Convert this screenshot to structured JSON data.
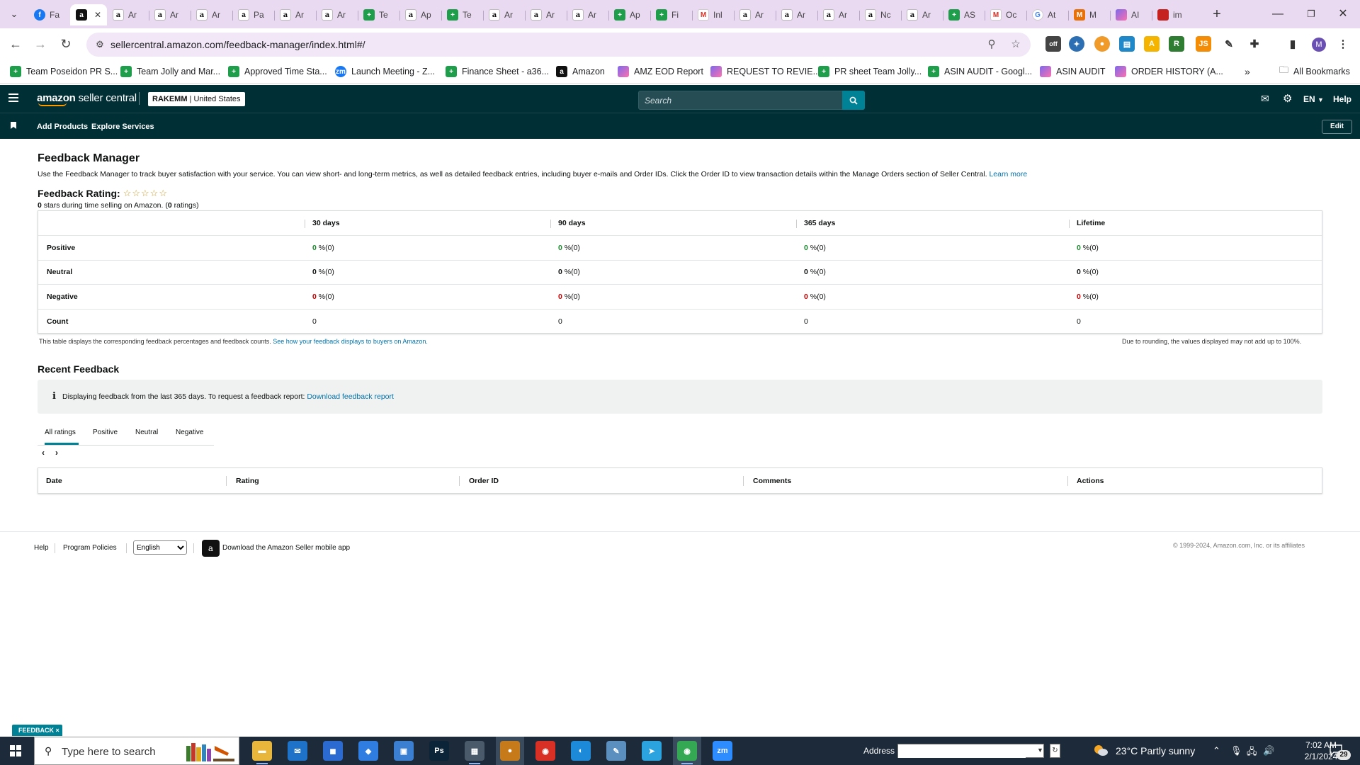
{
  "browser": {
    "tabs": [
      {
        "icon": "facebook-icon",
        "label": "Fa",
        "glyph": "f",
        "cls": "fb"
      },
      {
        "icon": "amazon-icon",
        "label": "",
        "glyph": "a",
        "cls": "active-amz",
        "active": true
      },
      {
        "icon": "amazon-icon",
        "label": "Ar",
        "glyph": "a",
        "cls": "amazon"
      },
      {
        "icon": "amazon-icon",
        "label": "Ar",
        "glyph": "a",
        "cls": "amazon"
      },
      {
        "icon": "amazon-icon",
        "label": "Ar",
        "glyph": "a",
        "cls": "amazon"
      },
      {
        "icon": "amazon-icon",
        "label": "Pa",
        "glyph": "a",
        "cls": "pa"
      },
      {
        "icon": "amazon-icon",
        "label": "Ar",
        "glyph": "a",
        "cls": "amazon"
      },
      {
        "icon": "amazon-icon",
        "label": "Ar",
        "glyph": "a",
        "cls": "amazon"
      },
      {
        "icon": "sheets-icon",
        "label": "Te",
        "glyph": "+",
        "cls": "sheets"
      },
      {
        "icon": "amazon-icon",
        "label": "Ap",
        "glyph": "a",
        "cls": "amazon"
      },
      {
        "icon": "sheets-icon",
        "label": "Te",
        "glyph": "+",
        "cls": "sheets"
      },
      {
        "icon": "amazon-icon",
        "label": "Ar",
        "glyph": "a",
        "cls": "amazon"
      },
      {
        "icon": "amazon-icon",
        "label": "Ar",
        "glyph": "a",
        "cls": "amazon"
      },
      {
        "icon": "amazon-icon",
        "label": "Ar",
        "glyph": "a",
        "cls": "amazon"
      },
      {
        "icon": "sheets-icon",
        "label": "Ap",
        "glyph": "+",
        "cls": "sheets"
      },
      {
        "icon": "sheets-icon",
        "label": "Fi",
        "glyph": "+",
        "cls": "sheets"
      },
      {
        "icon": "gmail-icon",
        "label": "Inl",
        "glyph": "M",
        "cls": "gmail"
      },
      {
        "icon": "amazon-icon",
        "label": "Ar",
        "glyph": "a",
        "cls": "amazon"
      },
      {
        "icon": "amazon-icon",
        "label": "Ar",
        "glyph": "a",
        "cls": "amazon"
      },
      {
        "icon": "amazon-icon",
        "label": "Ar",
        "glyph": "a",
        "cls": "amazon"
      },
      {
        "icon": "amazon-icon",
        "label": "Nc",
        "glyph": "a",
        "cls": "amazon"
      },
      {
        "icon": "amazon-icon",
        "label": "Ar",
        "glyph": "a",
        "cls": "amazon"
      },
      {
        "icon": "sheets-icon",
        "label": "AS",
        "glyph": "+",
        "cls": "sheets"
      },
      {
        "icon": "gmail-icon",
        "label": "Oc",
        "glyph": "M",
        "cls": "gmail"
      },
      {
        "icon": "google-icon",
        "label": "At",
        "glyph": "G",
        "cls": "google"
      },
      {
        "icon": "app-icon",
        "label": "M",
        "glyph": "M",
        "cls": "mix"
      },
      {
        "icon": "clickup-icon",
        "label": "AI",
        "glyph": "",
        "cls": "clickup"
      },
      {
        "icon": "app-icon",
        "label": "im",
        "glyph": "",
        "cls": "red"
      }
    ],
    "url": "sellercentral.amazon.com/feedback-manager/index.html#/",
    "bookmarks": [
      {
        "label": "Team Poseidon PR S...",
        "icon": "sheets-icon",
        "glyph": "+",
        "cls": "sheets"
      },
      {
        "label": "Team Jolly and Mar...",
        "icon": "sheets-icon",
        "glyph": "+",
        "cls": "sheets"
      },
      {
        "label": "Approved Time Sta...",
        "icon": "sheets-icon",
        "glyph": "+",
        "cls": "sheets"
      },
      {
        "label": "Launch Meeting - Z...",
        "icon": "zoom-icon",
        "glyph": "zm",
        "cls": "fb"
      },
      {
        "label": "Finance Sheet - a36...",
        "icon": "sheets-icon",
        "glyph": "+",
        "cls": "sheets"
      },
      {
        "label": "Amazon",
        "icon": "amazon-icon",
        "glyph": "a",
        "cls": "active-amz"
      },
      {
        "label": "AMZ EOD Report",
        "icon": "clickup-icon",
        "glyph": "",
        "cls": "clickup"
      },
      {
        "label": "REQUEST TO REVIE...",
        "icon": "clickup-icon",
        "glyph": "",
        "cls": "clickup"
      },
      {
        "label": "PR sheet Team Jolly...",
        "icon": "sheets-icon",
        "glyph": "+",
        "cls": "sheets"
      },
      {
        "label": "ASIN AUDIT - Googl...",
        "icon": "sheets-icon",
        "glyph": "+",
        "cls": "sheets"
      },
      {
        "label": "ASIN AUDIT",
        "icon": "clickup-icon",
        "glyph": "",
        "cls": "clickup"
      },
      {
        "label": "ORDER HISTORY (A...",
        "icon": "clickup-icon",
        "glyph": "",
        "cls": "clickup"
      }
    ],
    "all_bookmarks": "All Bookmarks",
    "profile_initial": "M"
  },
  "header": {
    "logo_bold": "amazon",
    "logo_light": " seller central",
    "store_name": "RAKEMM",
    "store_market": "United States",
    "search_placeholder": "Search",
    "lang": "EN",
    "help": "Help"
  },
  "subnav": {
    "links": [
      "Add Products",
      "Explore Services"
    ],
    "edit": "Edit"
  },
  "main": {
    "title": "Feedback Manager",
    "intro": "Use the Feedback Manager to track buyer satisfaction with your service. You can view short- and long-term metrics, as well as detailed feedback entries, including buyer e-mails and Order IDs. Click the Order ID to view transaction details within the Manage Orders section of Seller Central.",
    "learn_more": "Learn more",
    "rating_label": "Feedback Rating:",
    "stars": "☆☆☆☆☆",
    "rating_sub_a": "0",
    "rating_sub_b": " stars during time selling on Amazon. (",
    "rating_sub_c": "0",
    "rating_sub_d": " ratings)",
    "columns": [
      "30 days",
      "90 days",
      "365 days",
      "Lifetime"
    ],
    "rows": [
      {
        "label": "Positive",
        "cls": "pos",
        "cells": [
          {
            "num": "0",
            "rest": " %(0)"
          },
          {
            "num": "0",
            "rest": " %(0)"
          },
          {
            "num": "0",
            "rest": " %(0)"
          },
          {
            "num": "0",
            "rest": " %(0)"
          }
        ]
      },
      {
        "label": "Neutral",
        "cls": "neu",
        "cells": [
          {
            "num": "0",
            "rest": " %(0)"
          },
          {
            "num": "0",
            "rest": " %(0)"
          },
          {
            "num": "0",
            "rest": " %(0)"
          },
          {
            "num": "0",
            "rest": " %(0)"
          }
        ]
      },
      {
        "label": "Negative",
        "cls": "neg",
        "cells": [
          {
            "num": "0",
            "rest": " %(0)"
          },
          {
            "num": "0",
            "rest": " %(0)"
          },
          {
            "num": "0",
            "rest": " %(0)"
          },
          {
            "num": "0",
            "rest": " %(0)"
          }
        ]
      },
      {
        "label": "Count",
        "cls": "",
        "cells": [
          {
            "num": "",
            "rest": "0"
          },
          {
            "num": "",
            "rest": "0"
          },
          {
            "num": "",
            "rest": "0"
          },
          {
            "num": "",
            "rest": "0"
          }
        ]
      }
    ],
    "table_note": "This table displays the corresponding feedback percentages and feedback counts.",
    "table_note_link": "See how your feedback displays to buyers on Amazon.",
    "rounding_note": "Due to rounding, the values displayed may not add up to 100%.",
    "recent_title": "Recent Feedback",
    "info_text": "Displaying feedback from the last 365 days. To request a feedback report:",
    "info_link": "Download feedback report",
    "rating_tabs": [
      "All ratings",
      "Positive",
      "Neutral",
      "Negative"
    ],
    "feedback_columns": [
      "Date",
      "Rating",
      "Order ID",
      "Comments",
      "Actions"
    ]
  },
  "footer": {
    "help": "Help",
    "policies": "Program Policies",
    "language": "English",
    "app_text": "Download the Amazon Seller mobile app",
    "copyright": "© 1999-2024, Amazon.com, Inc. or its affiliates",
    "feedback_tab": "FEEDBACK ×"
  },
  "taskbar": {
    "search_placeholder": "Type here to search",
    "address_label": "Address",
    "weather": "23°C  Partly sunny",
    "time": "7:02 AM",
    "date": "2/1/2024",
    "notifications": "29",
    "apps": [
      {
        "name": "file-explorer-icon",
        "glyph": "▬",
        "bg": "#e8b63a"
      },
      {
        "name": "mail-icon",
        "glyph": "✉",
        "bg": "#1e73c9"
      },
      {
        "name": "store-icon",
        "glyph": "◼",
        "bg": "#2b6ad1"
      },
      {
        "name": "copilot-icon",
        "glyph": "◆",
        "bg": "#2f7de1"
      },
      {
        "name": "app-icon",
        "glyph": "▣",
        "bg": "#3a7fd1"
      },
      {
        "name": "photoshop-icon",
        "glyph": "Ps",
        "bg": "#0b2437"
      },
      {
        "name": "calculator-icon",
        "glyph": "▦",
        "bg": "#4a5a6a"
      },
      {
        "name": "media-icon",
        "glyph": "●",
        "bg": "#c77a1a"
      },
      {
        "name": "chrome-icon",
        "glyph": "◉",
        "bg": "#d93025"
      },
      {
        "name": "edge-icon",
        "glyph": "◐",
        "bg": "#1c8ad8"
      },
      {
        "name": "notes-icon",
        "glyph": "✎",
        "bg": "#5a8fc0"
      },
      {
        "name": "telegram-icon",
        "glyph": "➤",
        "bg": "#2aa3df"
      },
      {
        "name": "chrome-profile-icon",
        "glyph": "◉",
        "bg": "#34a853"
      },
      {
        "name": "zoom-icon",
        "glyph": "zm",
        "bg": "#2d8cff"
      }
    ]
  }
}
